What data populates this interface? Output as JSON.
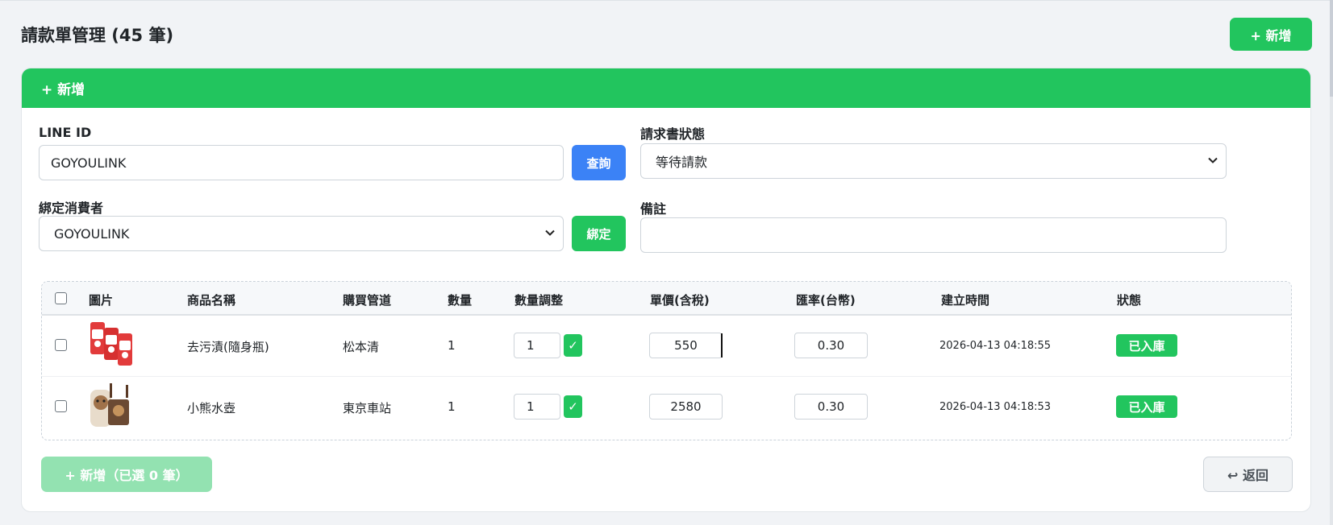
{
  "page": {
    "title": "請款單管理 (45 筆)",
    "add_button": "+ 新增"
  },
  "card": {
    "header": "+ 新增"
  },
  "form": {
    "line_id_label": "LINE ID",
    "line_id_value": "GOYOULINK",
    "query_button": "查詢",
    "status_label": "請求書狀態",
    "status_value": "等待請款",
    "consumer_label": "綁定消費者",
    "consumer_value": "GOYOULINK",
    "bind_button": "綁定",
    "note_label": "備註",
    "note_value": ""
  },
  "table": {
    "headers": {
      "image": "圖片",
      "name": "商品名稱",
      "channel": "購買管道",
      "qty": "數量",
      "qty_adjust": "數量調整",
      "unit_price": "單價(含稅)",
      "rate": "匯率(台幣)",
      "created": "建立時間",
      "status": "狀態"
    },
    "rows": [
      {
        "name": "去污漬(隨身瓶)",
        "channel": "松本清",
        "qty": "1",
        "qty_adjust": "1",
        "confirm": "✓",
        "unit_price": "550",
        "rate": "0.30",
        "created": "2026-04-13 04:18:55",
        "status": "已入庫"
      },
      {
        "name": "小熊水壺",
        "channel": "東京車站",
        "qty": "1",
        "qty_adjust": "1",
        "confirm": "✓",
        "unit_price": "2580",
        "rate": "0.30",
        "created": "2026-04-13 04:18:53",
        "status": "已入庫"
      }
    ]
  },
  "footer": {
    "add_selected": "+ 新增（已選 0 筆）",
    "back": "↩ 返回"
  },
  "colors": {
    "accent_green": "#22c55e",
    "accent_blue": "#3b82f6",
    "disabled_green": "#93e2b1"
  }
}
